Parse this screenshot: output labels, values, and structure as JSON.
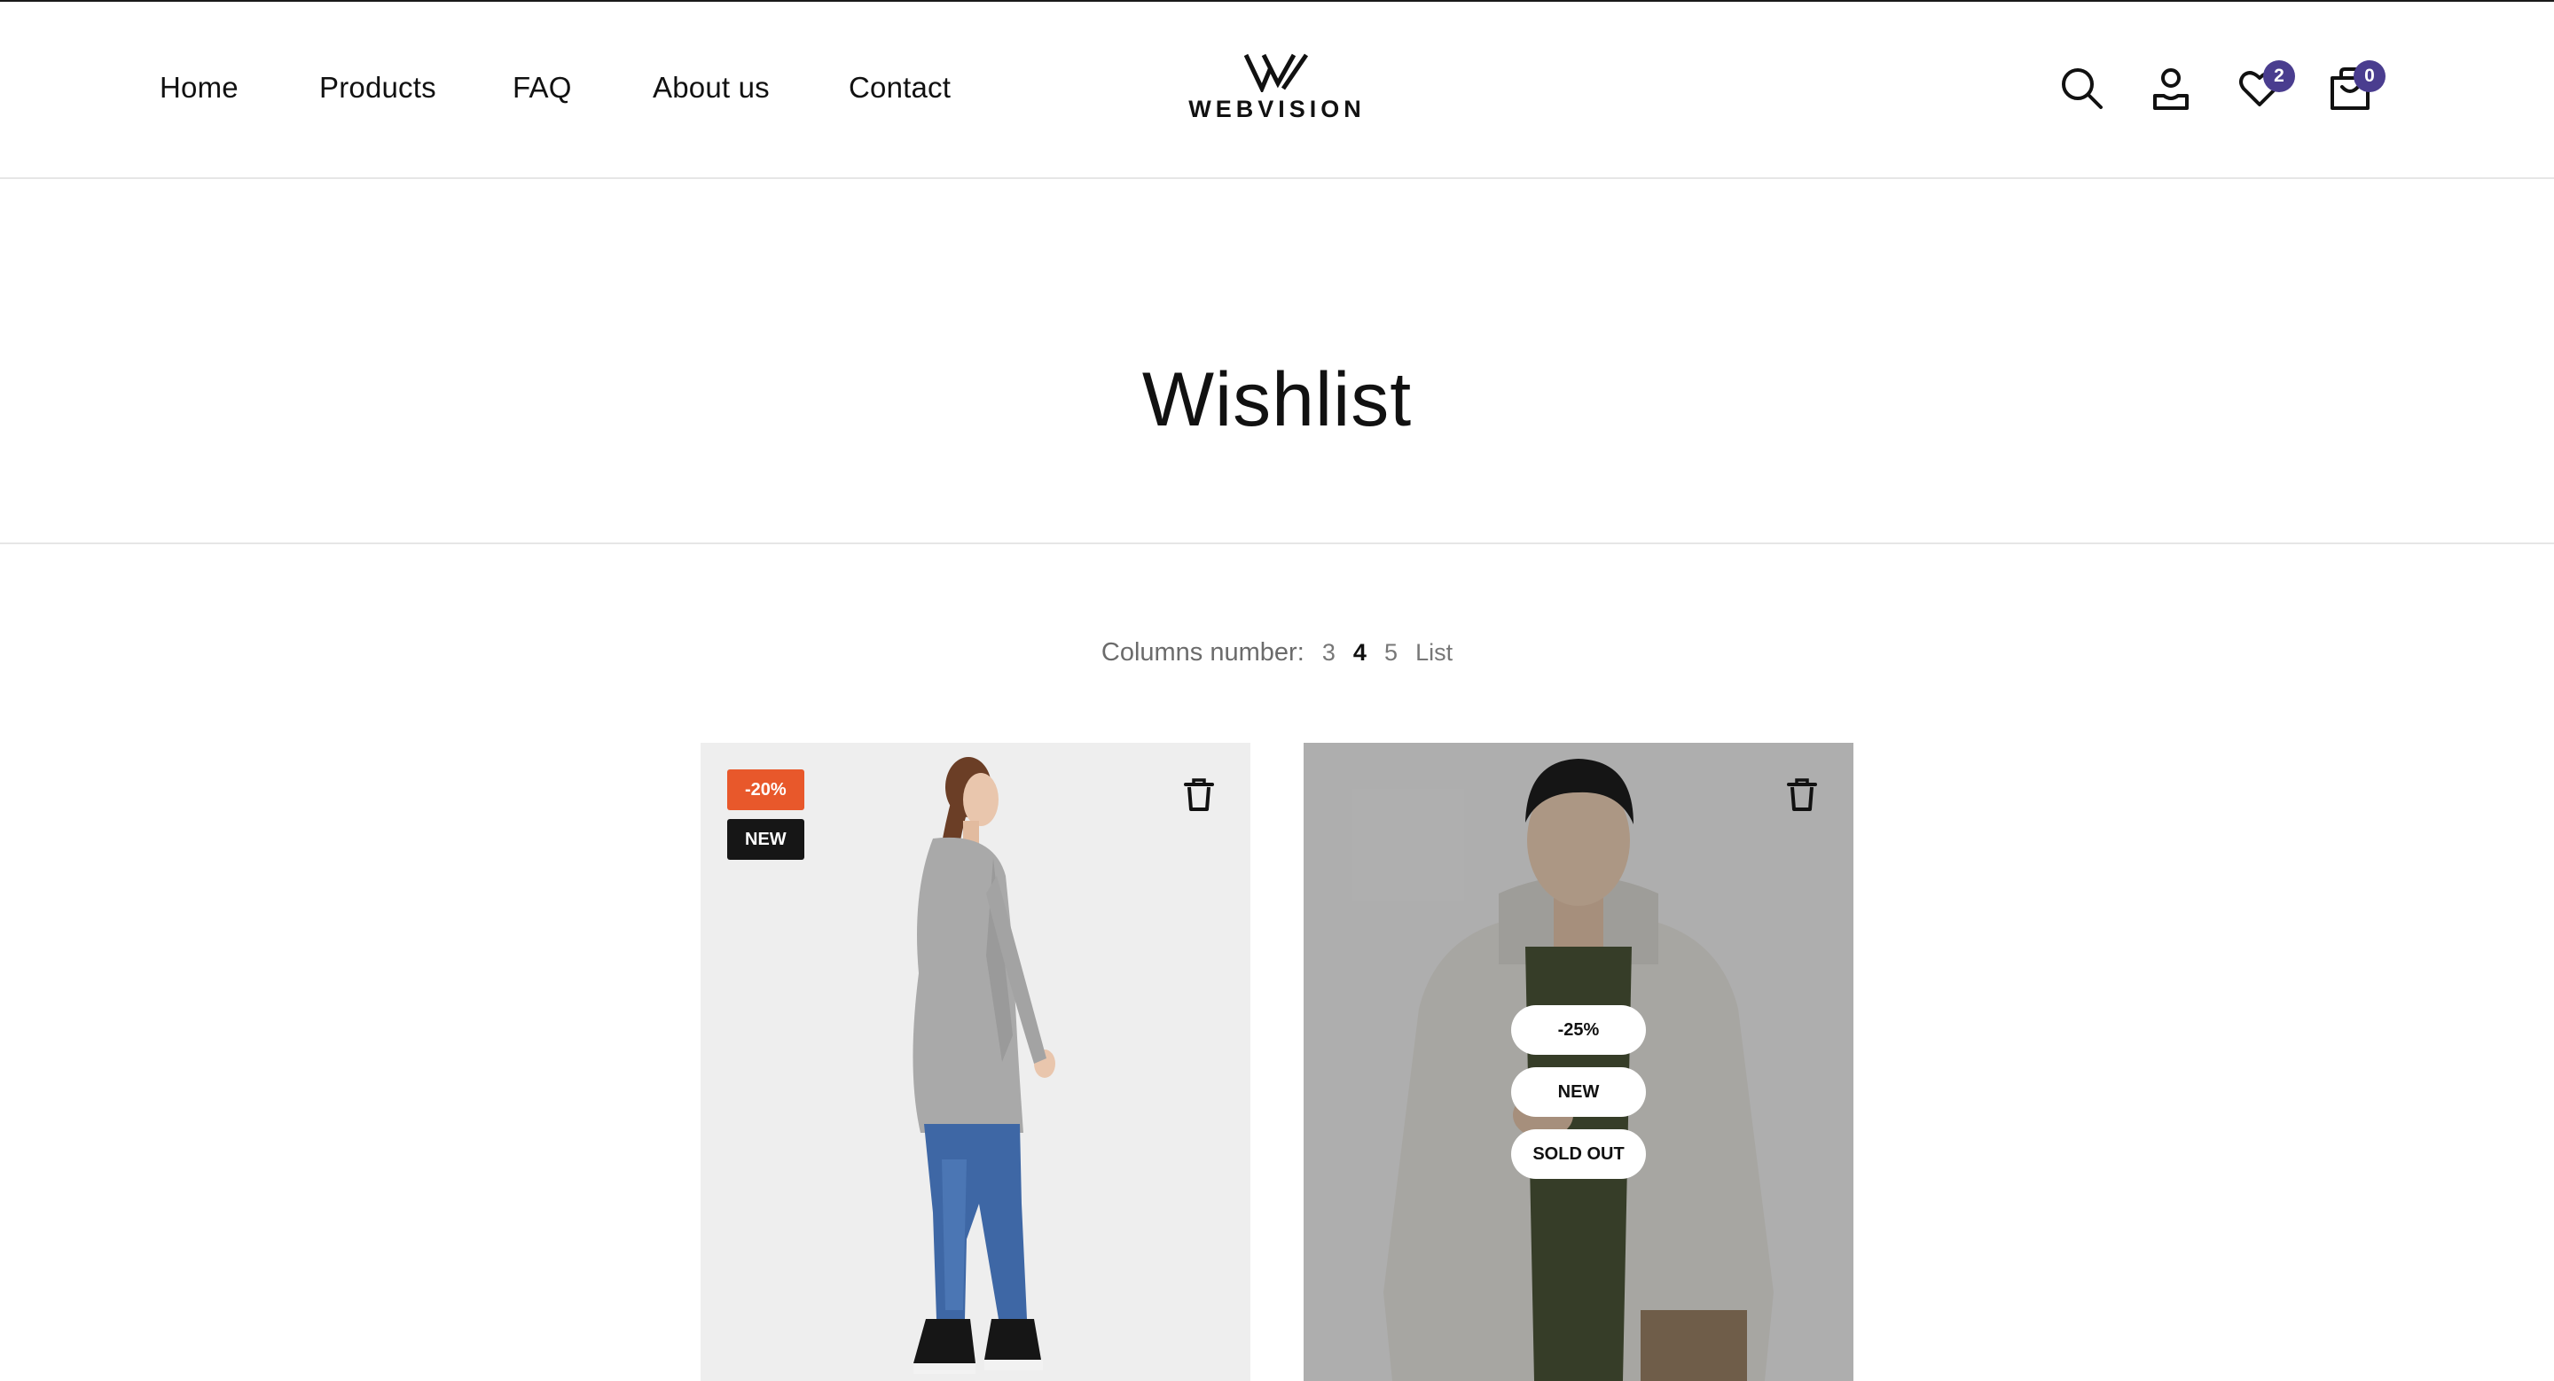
{
  "header": {
    "nav": [
      {
        "label": "Home"
      },
      {
        "label": "Products"
      },
      {
        "label": "FAQ"
      },
      {
        "label": "About us"
      },
      {
        "label": "Contact"
      }
    ],
    "logo_text": "WEBVISION",
    "icons": {
      "search": "search-icon",
      "account": "account-icon",
      "wishlist": "heart-icon",
      "cart": "shopping-bag-icon"
    },
    "wishlist_count": "2",
    "cart_count": "0",
    "badge_color": "#4a3d8f"
  },
  "page": {
    "title": "Wishlist"
  },
  "columns": {
    "label": "Columns number:",
    "options": [
      "3",
      "4",
      "5",
      "List"
    ],
    "selected": "4"
  },
  "products": [
    {
      "badges": [
        "-20%",
        "NEW"
      ],
      "badge_colors": [
        "#e8582b",
        "#161616"
      ],
      "remove_icon": "trash-icon"
    },
    {
      "badges": [
        "-25%",
        "NEW",
        "SOLD OUT"
      ],
      "remove_icon": "trash-icon"
    }
  ]
}
